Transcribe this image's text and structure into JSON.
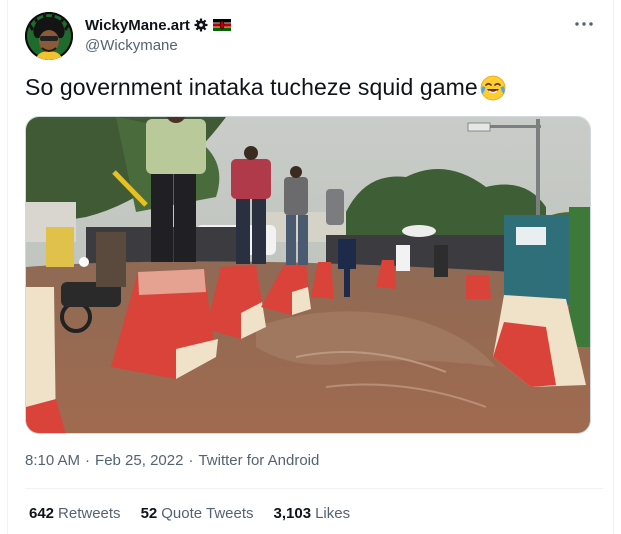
{
  "author": {
    "display_name": "WickyMane.art",
    "handle": "@Wickymane",
    "avatar_icon": "avatar-illustration",
    "badge_icon": "gear-badge-icon",
    "flag_icon": "kenya-flag-icon"
  },
  "tweet": {
    "text": "So government inataka tucheze squid game",
    "emoji_icon": "face-with-tears-of-joy-emoji",
    "media_description_icon": "photo"
  },
  "meta": {
    "time": "8:10 AM",
    "separator1": "·",
    "date": "Feb 25, 2022",
    "separator2": "·",
    "source": "Twitter for Android"
  },
  "stats": {
    "retweets_count": "642",
    "retweets_label": "Retweets",
    "quotes_count": "52",
    "quotes_label": "Quote Tweets",
    "likes_count": "3,103",
    "likes_label": "Likes"
  },
  "colors": {
    "text_primary": "#0f1419",
    "text_secondary": "#536471",
    "divider": "#eff3f4",
    "barrier_red": "#d9433a",
    "barrier_cream": "#efe2c9",
    "flood_water": "#9a6a4f"
  }
}
